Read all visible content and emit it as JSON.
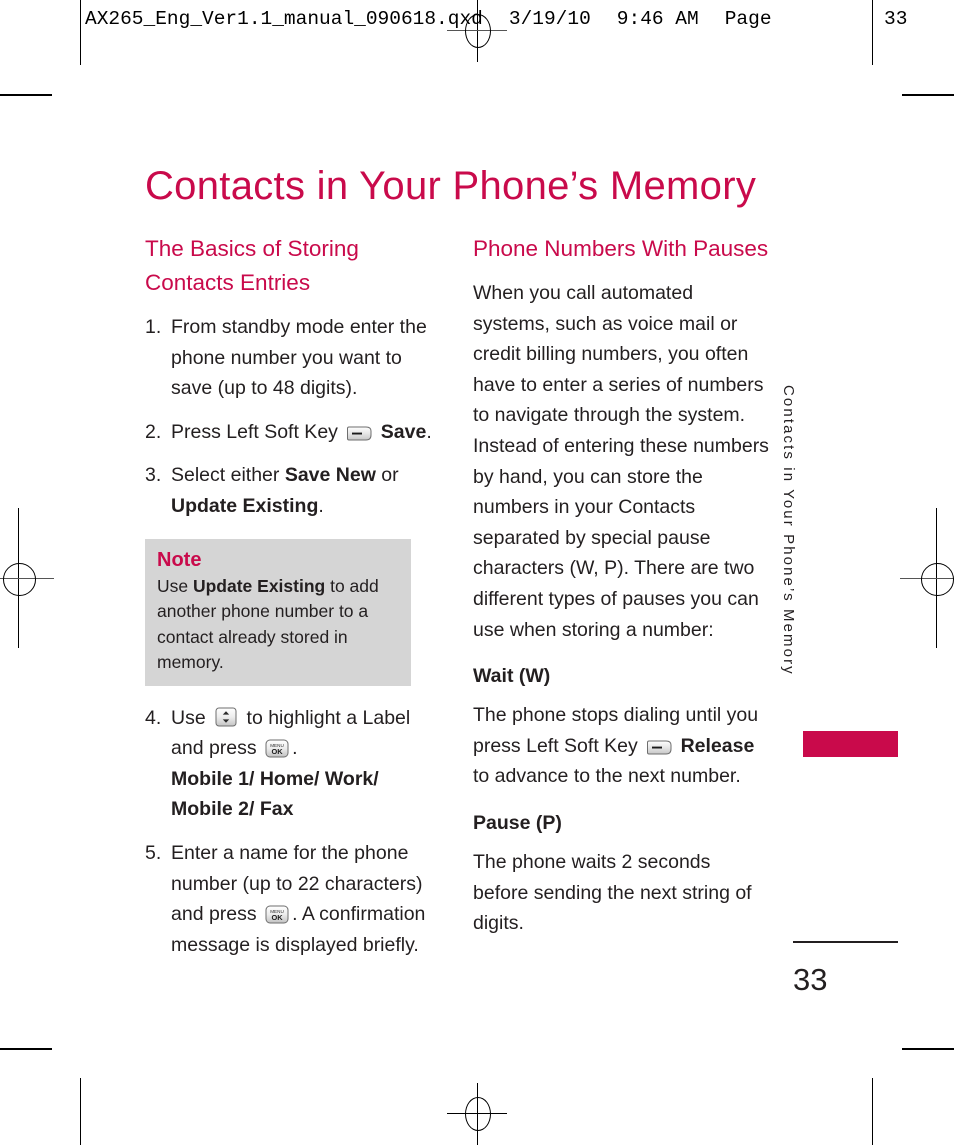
{
  "prepress": {
    "file_name": "AX265_Eng_Ver1.1_manual_090618.qxd",
    "date": "3/19/10",
    "time": "9:46 AM",
    "page_label": "Page",
    "page_number_header": "33"
  },
  "page": {
    "title": "Contacts in Your Phone’s Memory",
    "accent_color": "#c90a4b",
    "text_color": "#231f20",
    "note_bg_color": "#d5d5d5",
    "side_tab_label": "Contacts in Your Phone’s Memory",
    "page_number": "33"
  },
  "left_column": {
    "heading": "The Basics of Storing Contacts Entries",
    "steps": [
      {
        "number": "1.",
        "segments": [
          {
            "type": "text",
            "value": "From standby mode enter the phone number you want to save (up to 48 digits)."
          }
        ]
      },
      {
        "number": "2.",
        "segments": [
          {
            "type": "text",
            "value": "Press Left Soft Key "
          },
          {
            "type": "icon",
            "value": "soft-key-icon"
          },
          {
            "type": "bold",
            "value": " Save"
          },
          {
            "type": "text",
            "value": "."
          }
        ]
      },
      {
        "number": "3.",
        "segments": [
          {
            "type": "text",
            "value": "Select either "
          },
          {
            "type": "bold",
            "value": "Save New"
          },
          {
            "type": "text",
            "value": " or "
          },
          {
            "type": "bold",
            "value": "Update Existing"
          },
          {
            "type": "text",
            "value": "."
          }
        ]
      },
      {
        "number": "4.",
        "segments": [
          {
            "type": "text",
            "value": "Use "
          },
          {
            "type": "icon",
            "value": "nav-up-down-icon"
          },
          {
            "type": "text",
            "value": " to highlight a Label and press "
          },
          {
            "type": "icon",
            "value": "menu-ok-icon"
          },
          {
            "type": "text",
            "value": "."
          },
          {
            "type": "break",
            "value": ""
          },
          {
            "type": "bold",
            "value": "Mobile 1/ Home/ Work/ Mobile 2/ Fax"
          }
        ]
      },
      {
        "number": "5.",
        "segments": [
          {
            "type": "text",
            "value": "Enter a name for the phone number (up to 22 characters) and press "
          },
          {
            "type": "icon",
            "value": "menu-ok-icon"
          },
          {
            "type": "text",
            "value": ". A confirmation message is displayed briefly."
          }
        ]
      }
    ],
    "note": {
      "title": "Note",
      "segments": [
        {
          "type": "text",
          "value": "Use "
        },
        {
          "type": "bold",
          "value": "Update Existing"
        },
        {
          "type": "text",
          "value": " to add another phone number to a contact already stored in memory."
        }
      ]
    }
  },
  "right_column": {
    "heading": "Phone Numbers With Pauses",
    "intro": "When you call automated systems, such as voice mail or credit billing numbers, you often have to enter a series of numbers to navigate through the system. Instead of entering these numbers by hand, you can store the numbers in your Contacts separated by special pause characters (W, P). There are two different types of pauses you can use when storing a number:",
    "subsections": [
      {
        "heading": "Wait (W)",
        "segments": [
          {
            "type": "text",
            "value": "The phone stops dialing until you press Left Soft Key "
          },
          {
            "type": "icon",
            "value": "soft-key-icon"
          },
          {
            "type": "bold",
            "value": " Release"
          },
          {
            "type": "text",
            "value": " to advance to the next number."
          }
        ]
      },
      {
        "heading": "Pause (P)",
        "segments": [
          {
            "type": "text",
            "value": "The phone waits 2 seconds before sending the next string of digits."
          }
        ]
      }
    ]
  }
}
